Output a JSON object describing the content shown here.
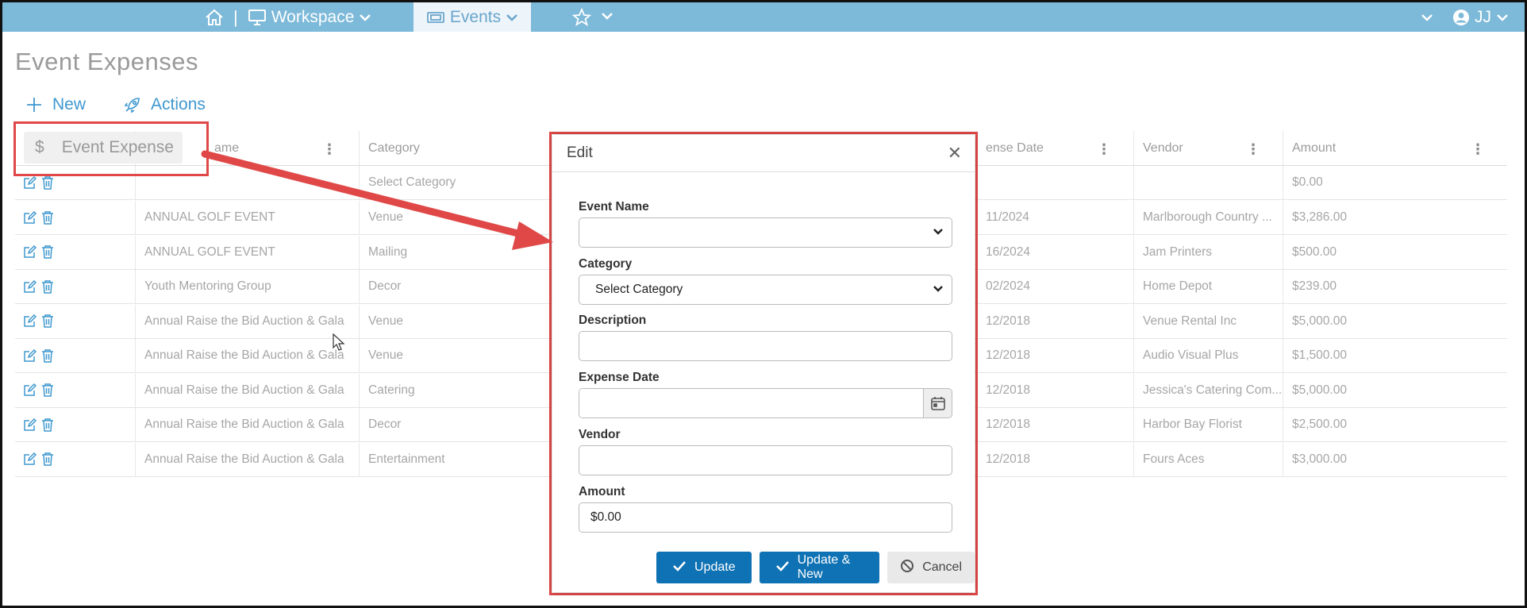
{
  "nav": {
    "workspace_label": "Workspace",
    "separator": "|",
    "events_label": "Events",
    "user_initials": "JJ"
  },
  "page": {
    "title": "Event Expenses"
  },
  "toolbar": {
    "new_label": "New",
    "actions_label": "Actions"
  },
  "drag_ghost": {
    "label": "Event Expense"
  },
  "grid": {
    "columns": [
      "Event Name",
      "Category",
      "Expense Date",
      "Vendor",
      "Amount"
    ],
    "visible_headers": {
      "event_name_partial": "ame",
      "category": "Category",
      "expense_date_partial": "ense Date",
      "vendor": "Vendor",
      "amount": "Amount"
    },
    "new_row": {
      "category": "Select Category",
      "amount": "$0.00"
    },
    "rows": [
      {
        "event": "ANNUAL GOLF EVENT",
        "category": "Venue",
        "date": "11/2024",
        "vendor": "Marlborough Country ...",
        "amount": "$3,286.00"
      },
      {
        "event": "ANNUAL GOLF EVENT",
        "category": "Mailing",
        "date": "16/2024",
        "vendor": "Jam Printers",
        "amount": "$500.00"
      },
      {
        "event": "Youth Mentoring Group",
        "category": "Decor",
        "date": "02/2024",
        "vendor": "Home Depot",
        "amount": "$239.00"
      },
      {
        "event": "Annual Raise the Bid Auction & Gala",
        "category": "Venue",
        "date": "12/2018",
        "vendor": "Venue Rental Inc",
        "amount": "$5,000.00"
      },
      {
        "event": "Annual Raise the Bid Auction & Gala",
        "category": "Venue",
        "date": "12/2018",
        "vendor": "Audio Visual Plus",
        "amount": "$1,500.00"
      },
      {
        "event": "Annual Raise the Bid Auction & Gala",
        "category": "Catering",
        "date": "12/2018",
        "vendor": "Jessica's Catering Com...",
        "amount": "$5,000.00"
      },
      {
        "event": "Annual Raise the Bid Auction & Gala",
        "category": "Decor",
        "date": "12/2018",
        "vendor": "Harbor Bay Florist",
        "amount": "$2,500.00"
      },
      {
        "event": "Annual Raise the Bid Auction & Gala",
        "category": "Entertainment",
        "date": "12/2018",
        "vendor": "Fours Aces",
        "amount": "$3,000.00"
      }
    ]
  },
  "modal": {
    "title": "Edit",
    "fields": {
      "event_name": {
        "label": "Event Name",
        "value": ""
      },
      "category": {
        "label": "Category",
        "value": "Select Category"
      },
      "description": {
        "label": "Description",
        "value": ""
      },
      "expense_date": {
        "label": "Expense Date",
        "value": ""
      },
      "vendor": {
        "label": "Vendor",
        "value": ""
      },
      "amount": {
        "label": "Amount",
        "value": "$0.00"
      }
    },
    "buttons": {
      "update": "Update",
      "update_new": "Update & New",
      "cancel": "Cancel"
    }
  },
  "colors": {
    "nav_bg": "#7db9d9",
    "accent": "#3f98cf",
    "primary_button": "#0f72b4",
    "highlight": "#e04848"
  },
  "icons": [
    "home-icon",
    "monitor-icon",
    "ticket-icon",
    "star-icon",
    "user-circle-icon",
    "plus-icon",
    "rocket-icon",
    "dollar-icon",
    "edit-icon",
    "trash-icon",
    "kebab-icon",
    "close-icon",
    "calendar-icon",
    "check-icon",
    "ban-icon"
  ]
}
